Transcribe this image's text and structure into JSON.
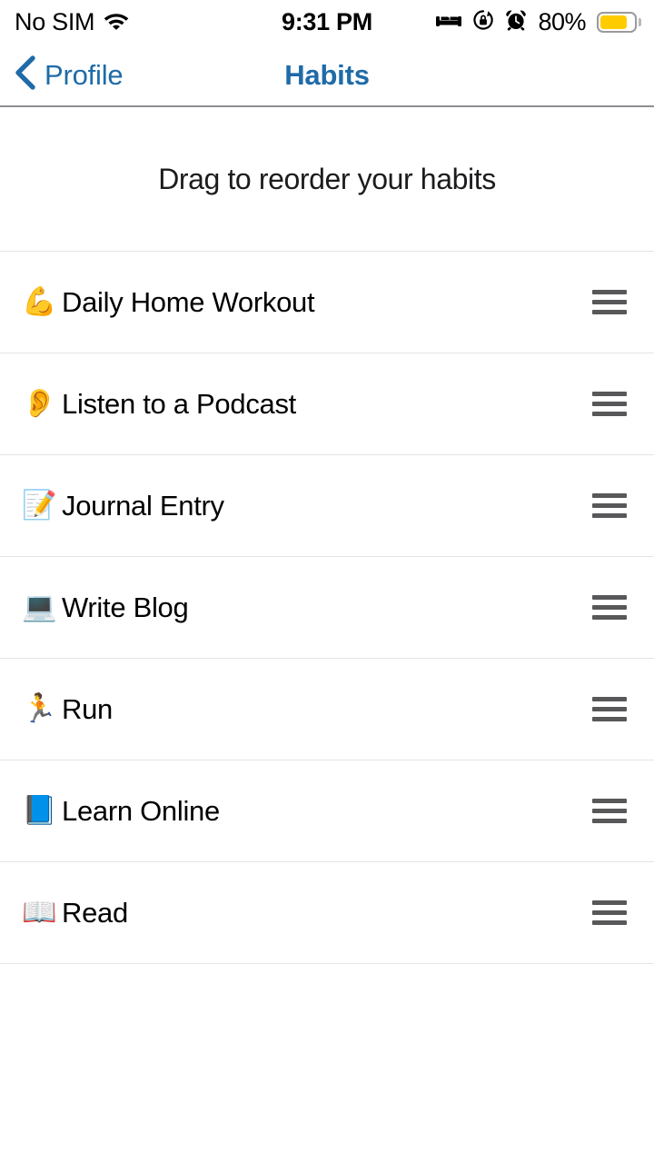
{
  "status_bar": {
    "carrier": "No SIM",
    "wifi_icon": "wifi-icon",
    "time": "9:31 PM",
    "icons": [
      {
        "name": "sleep-mode-icon",
        "glyph": "bed"
      },
      {
        "name": "rotation-lock-icon",
        "glyph": "rotation-lock"
      },
      {
        "name": "alarm-clock-icon",
        "glyph": "alarm"
      }
    ],
    "battery_percent_label": "80%",
    "battery_level": 80,
    "battery_color": "#ffcc00"
  },
  "nav_bar": {
    "back_icon": "chevron-left-icon",
    "back_label": "Profile",
    "title": "Habits",
    "accent_color": "#1f6ba8"
  },
  "list_header": {
    "text": "Drag to reorder your habits"
  },
  "habits": [
    {
      "emoji": "💪",
      "emoji_name": "flexed-biceps-emoji",
      "label": "Daily Home Workout",
      "handle_icon": "drag-handle-icon"
    },
    {
      "emoji": "👂",
      "emoji_name": "ear-emoji",
      "label": "Listen to a Podcast",
      "handle_icon": "drag-handle-icon"
    },
    {
      "emoji": "📝",
      "emoji_name": "memo-emoji",
      "label": "Journal Entry",
      "handle_icon": "drag-handle-icon"
    },
    {
      "emoji": "💻",
      "emoji_name": "laptop-emoji",
      "label": "Write Blog",
      "handle_icon": "drag-handle-icon"
    },
    {
      "emoji": "🏃",
      "emoji_name": "runner-emoji",
      "label": "Run",
      "handle_icon": "drag-handle-icon"
    },
    {
      "emoji": "📘",
      "emoji_name": "blue-book-emoji",
      "label": "Learn Online",
      "handle_icon": "drag-handle-icon"
    },
    {
      "emoji": "📖",
      "emoji_name": "open-book-emoji",
      "label": "Read",
      "handle_icon": "drag-handle-icon"
    }
  ],
  "colors": {
    "background": "#ffffff",
    "separator": "#e4e4e6",
    "nav_border": "#8e8e93",
    "text_primary": "#000000",
    "handle_gray": "#58585a"
  }
}
